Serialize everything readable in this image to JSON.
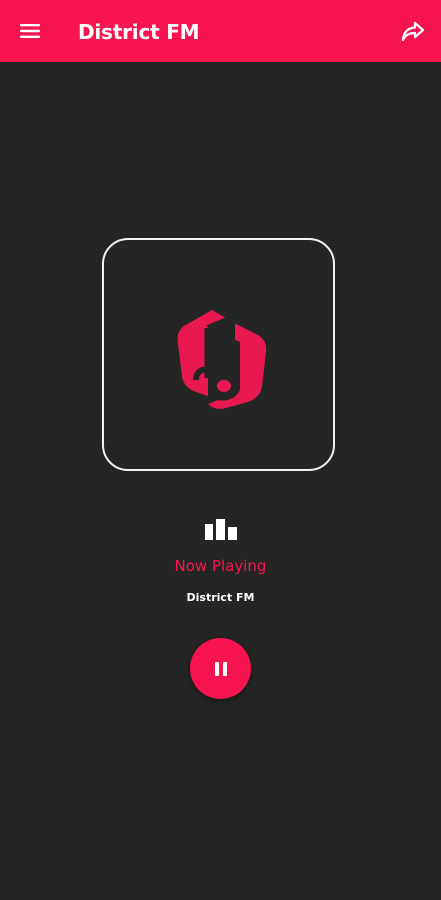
{
  "appbar": {
    "title": "District FM",
    "menu_icon": "hamburger-menu-icon",
    "share_icon": "share-arrow-icon"
  },
  "player": {
    "artwork_icon": "music-note-logo-icon",
    "visualizer_icon": "equalizer-bars-icon",
    "status_label": "Now Playing",
    "station_name": "District FM",
    "control_icon": "pause-icon"
  },
  "colors": {
    "accent": "#f7144f",
    "background": "#252525",
    "text": "#ffffff",
    "frame": "#f2f2f2"
  }
}
